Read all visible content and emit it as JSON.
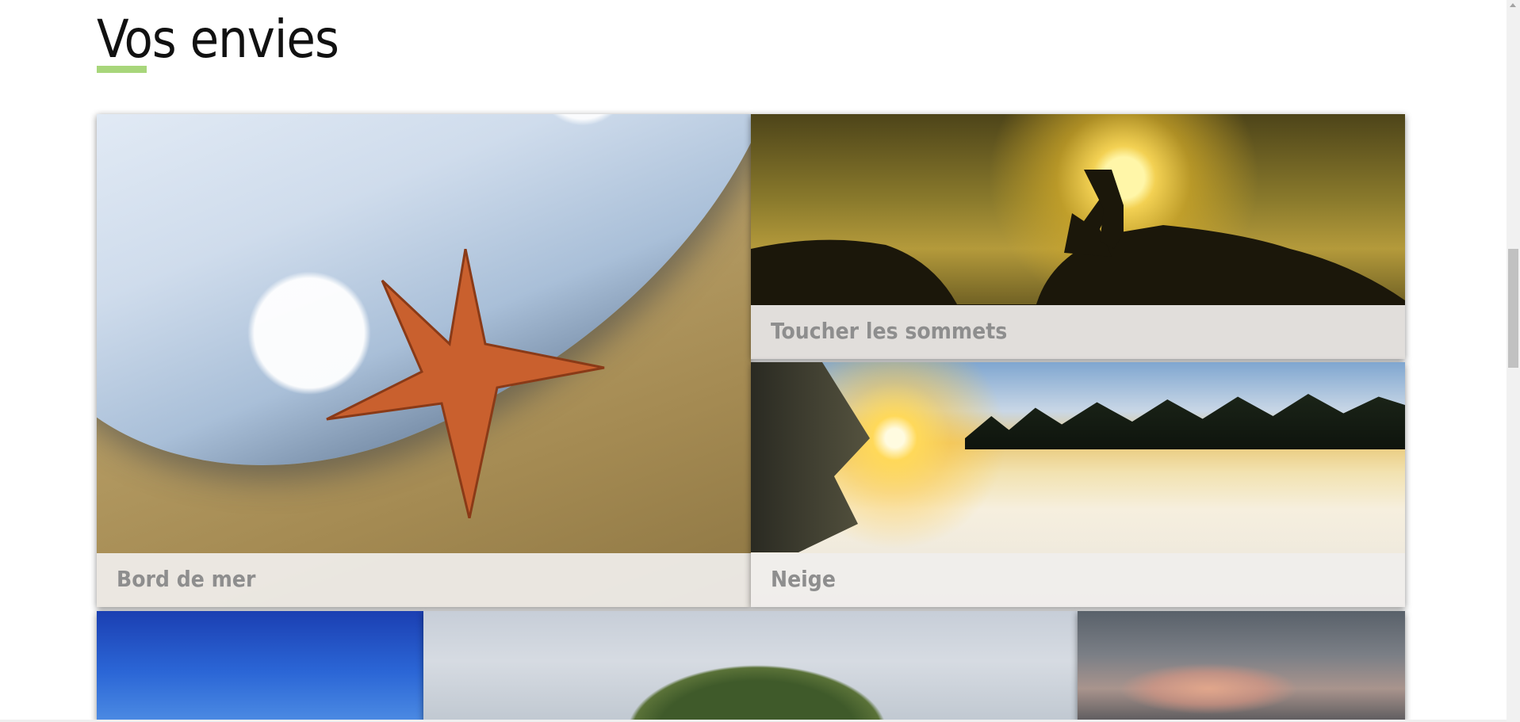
{
  "section": {
    "title": "Vos envies",
    "underline_color": "#a8d67b"
  },
  "tiles": [
    {
      "caption": "Bord de mer"
    },
    {
      "caption": "Toucher les sommets"
    },
    {
      "caption": "Neige"
    }
  ]
}
